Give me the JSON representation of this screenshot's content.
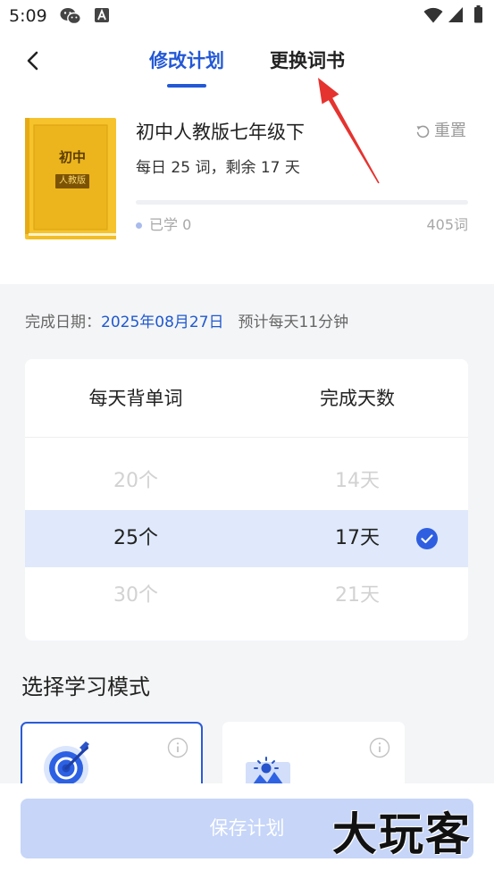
{
  "status_bar": {
    "time": "5:09",
    "left_icons": [
      "wechat-icon",
      "text-notification-icon"
    ],
    "right_icons": [
      "wifi-icon",
      "signal-icon",
      "battery-icon"
    ]
  },
  "header": {
    "back_icon": "chevron-left-icon",
    "tabs": [
      {
        "label": "修改计划",
        "active": true
      },
      {
        "label": "更换词书",
        "active": false
      }
    ]
  },
  "book": {
    "cover": {
      "title": "初中",
      "tag": "人教版"
    },
    "title": "初中人教版七年级下",
    "reset": {
      "icon": "refresh-icon",
      "label": "重置"
    },
    "summary": "每日 25 词，剩余 17 天",
    "progress": 0,
    "learned_label": "已学 0",
    "total_label": "405词"
  },
  "schedule": {
    "finish_label": "完成日期：",
    "finish_date": "2025年08月27日",
    "estimate": "预计每天11分钟"
  },
  "picker": {
    "headers": {
      "words": "每天背单词",
      "days": "完成天数"
    },
    "rows": [
      {
        "words": "20个",
        "days": "14天",
        "selected": false
      },
      {
        "words": "25个",
        "days": "17天",
        "selected": true
      },
      {
        "words": "30个",
        "days": "21天",
        "selected": false
      }
    ],
    "selected_icon": "check-circle-icon"
  },
  "modes": {
    "title": "选择学习模式",
    "options": [
      {
        "icon": "target-icon",
        "info_icon": "info-icon",
        "selected": true
      },
      {
        "icon": "image-icon",
        "info_icon": "info-icon",
        "selected": false
      }
    ]
  },
  "footer": {
    "save_label": "保存计划"
  },
  "watermark": "大玩客",
  "annotation": {
    "icon": "red-arrow",
    "color": "#e5332f"
  },
  "colors": {
    "accent": "#2358d6",
    "section_bg": "#f4f5f7",
    "selected_row": "#dfe9fb",
    "save_button": "#c6d5f8",
    "book_cover": "#f6c32c"
  }
}
